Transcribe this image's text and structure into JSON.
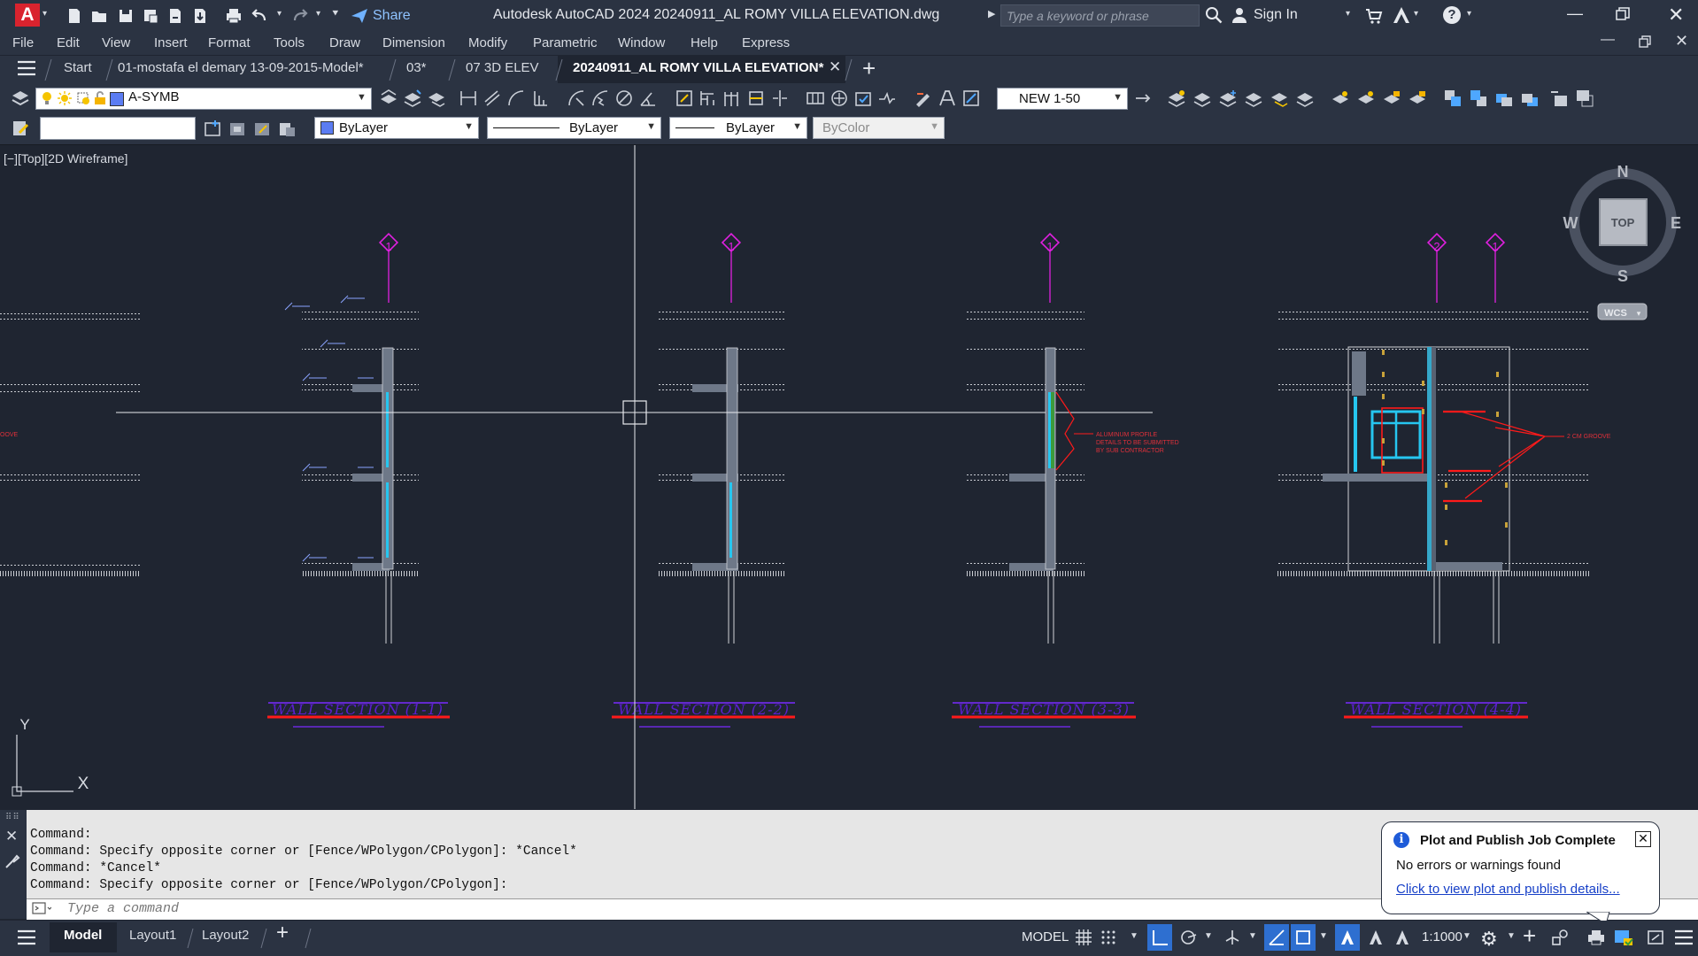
{
  "app": {
    "logo": "A",
    "title": "Autodesk AutoCAD 2024    20240911_AL ROMY VILLA ELEVATION.dwg",
    "share_label": "Share",
    "search_placeholder": "Type a keyword or phrase",
    "signin_label": "Sign In"
  },
  "menu": [
    "File",
    "Edit",
    "View",
    "Insert",
    "Format",
    "Tools",
    "Draw",
    "Dimension",
    "Modify",
    "Parametric",
    "Window",
    "Help",
    "Express"
  ],
  "tabs": {
    "start": "Start",
    "items": [
      "01-mostafa el demary 13-09-2015-Model*",
      "03*",
      "07 3D ELEV",
      "20240911_AL ROMY VILLA ELEVATION*"
    ],
    "active_index": 3
  },
  "toolbar": {
    "layer_name": "A-SYMB",
    "annotation_scale": "NEW 1-50",
    "color": "ByLayer",
    "linetype": "ByLayer",
    "lineweight": "ByLayer",
    "plotstyle": "ByColor"
  },
  "viewport": {
    "label": "[−][Top][2D Wireframe]",
    "viewcube": {
      "n": "N",
      "s": "S",
      "e": "E",
      "w": "W",
      "face": "TOP",
      "ucs": "WCS"
    },
    "ucs_icon": {
      "x": "X",
      "y": "Y"
    }
  },
  "drawing": {
    "grid_bubbles": [
      "1",
      "1",
      "1",
      "2",
      "1"
    ],
    "section_titles": [
      "WALL SECTION (1-1)",
      "WALL SECTION (2-2)",
      "WALL SECTION (3-3)",
      "WALL SECTION (4-4)"
    ],
    "note_aluminum": [
      "ALUMINUM PROFILE",
      "DETAILS TO BE SUBMITTED",
      "BY SUB CONTRACTOR"
    ],
    "note_groove": "2 CM GROOVE",
    "note_groove_left": "OOVE"
  },
  "command": {
    "lines": [
      "Command:",
      "Command: Specify opposite corner or [Fence/WPolygon/CPolygon]: *Cancel*",
      "Command: *Cancel*",
      "Command: Specify opposite corner or [Fence/WPolygon/CPolygon]:"
    ],
    "placeholder": "Type a command"
  },
  "layouts": [
    "Model",
    "Layout1",
    "Layout2"
  ],
  "status": {
    "model_label": "MODEL",
    "scale": "1:1000"
  },
  "notification": {
    "title": "Plot and Publish Job Complete",
    "body": "No errors or warnings found",
    "link": "Click to view plot and publish details..."
  },
  "colors": {
    "chrome": "#2b3342",
    "canvas": "#1f2531",
    "magenta": "#ff19ff",
    "section_red": "#ff1a1a",
    "cyan": "#26c6f0"
  }
}
